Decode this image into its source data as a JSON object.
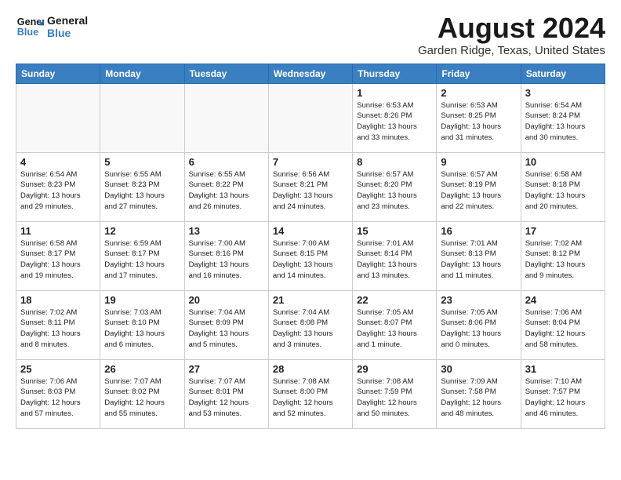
{
  "logo": {
    "line1": "General",
    "line2": "Blue"
  },
  "title": "August 2024",
  "location": "Garden Ridge, Texas, United States",
  "weekdays": [
    "Sunday",
    "Monday",
    "Tuesday",
    "Wednesday",
    "Thursday",
    "Friday",
    "Saturday"
  ],
  "weeks": [
    [
      {
        "day": "",
        "info": ""
      },
      {
        "day": "",
        "info": ""
      },
      {
        "day": "",
        "info": ""
      },
      {
        "day": "",
        "info": ""
      },
      {
        "day": "1",
        "info": "Sunrise: 6:53 AM\nSunset: 8:26 PM\nDaylight: 13 hours\nand 33 minutes."
      },
      {
        "day": "2",
        "info": "Sunrise: 6:53 AM\nSunset: 8:25 PM\nDaylight: 13 hours\nand 31 minutes."
      },
      {
        "day": "3",
        "info": "Sunrise: 6:54 AM\nSunset: 8:24 PM\nDaylight: 13 hours\nand 30 minutes."
      }
    ],
    [
      {
        "day": "4",
        "info": "Sunrise: 6:54 AM\nSunset: 8:23 PM\nDaylight: 13 hours\nand 29 minutes."
      },
      {
        "day": "5",
        "info": "Sunrise: 6:55 AM\nSunset: 8:23 PM\nDaylight: 13 hours\nand 27 minutes."
      },
      {
        "day": "6",
        "info": "Sunrise: 6:55 AM\nSunset: 8:22 PM\nDaylight: 13 hours\nand 26 minutes."
      },
      {
        "day": "7",
        "info": "Sunrise: 6:56 AM\nSunset: 8:21 PM\nDaylight: 13 hours\nand 24 minutes."
      },
      {
        "day": "8",
        "info": "Sunrise: 6:57 AM\nSunset: 8:20 PM\nDaylight: 13 hours\nand 23 minutes."
      },
      {
        "day": "9",
        "info": "Sunrise: 6:57 AM\nSunset: 8:19 PM\nDaylight: 13 hours\nand 22 minutes."
      },
      {
        "day": "10",
        "info": "Sunrise: 6:58 AM\nSunset: 8:18 PM\nDaylight: 13 hours\nand 20 minutes."
      }
    ],
    [
      {
        "day": "11",
        "info": "Sunrise: 6:58 AM\nSunset: 8:17 PM\nDaylight: 13 hours\nand 19 minutes."
      },
      {
        "day": "12",
        "info": "Sunrise: 6:59 AM\nSunset: 8:17 PM\nDaylight: 13 hours\nand 17 minutes."
      },
      {
        "day": "13",
        "info": "Sunrise: 7:00 AM\nSunset: 8:16 PM\nDaylight: 13 hours\nand 16 minutes."
      },
      {
        "day": "14",
        "info": "Sunrise: 7:00 AM\nSunset: 8:15 PM\nDaylight: 13 hours\nand 14 minutes."
      },
      {
        "day": "15",
        "info": "Sunrise: 7:01 AM\nSunset: 8:14 PM\nDaylight: 13 hours\nand 13 minutes."
      },
      {
        "day": "16",
        "info": "Sunrise: 7:01 AM\nSunset: 8:13 PM\nDaylight: 13 hours\nand 11 minutes."
      },
      {
        "day": "17",
        "info": "Sunrise: 7:02 AM\nSunset: 8:12 PM\nDaylight: 13 hours\nand 9 minutes."
      }
    ],
    [
      {
        "day": "18",
        "info": "Sunrise: 7:02 AM\nSunset: 8:11 PM\nDaylight: 13 hours\nand 8 minutes."
      },
      {
        "day": "19",
        "info": "Sunrise: 7:03 AM\nSunset: 8:10 PM\nDaylight: 13 hours\nand 6 minutes."
      },
      {
        "day": "20",
        "info": "Sunrise: 7:04 AM\nSunset: 8:09 PM\nDaylight: 13 hours\nand 5 minutes."
      },
      {
        "day": "21",
        "info": "Sunrise: 7:04 AM\nSunset: 8:08 PM\nDaylight: 13 hours\nand 3 minutes."
      },
      {
        "day": "22",
        "info": "Sunrise: 7:05 AM\nSunset: 8:07 PM\nDaylight: 13 hours\nand 1 minute."
      },
      {
        "day": "23",
        "info": "Sunrise: 7:05 AM\nSunset: 8:06 PM\nDaylight: 13 hours\nand 0 minutes."
      },
      {
        "day": "24",
        "info": "Sunrise: 7:06 AM\nSunset: 8:04 PM\nDaylight: 12 hours\nand 58 minutes."
      }
    ],
    [
      {
        "day": "25",
        "info": "Sunrise: 7:06 AM\nSunset: 8:03 PM\nDaylight: 12 hours\nand 57 minutes."
      },
      {
        "day": "26",
        "info": "Sunrise: 7:07 AM\nSunset: 8:02 PM\nDaylight: 12 hours\nand 55 minutes."
      },
      {
        "day": "27",
        "info": "Sunrise: 7:07 AM\nSunset: 8:01 PM\nDaylight: 12 hours\nand 53 minutes."
      },
      {
        "day": "28",
        "info": "Sunrise: 7:08 AM\nSunset: 8:00 PM\nDaylight: 12 hours\nand 52 minutes."
      },
      {
        "day": "29",
        "info": "Sunrise: 7:08 AM\nSunset: 7:59 PM\nDaylight: 12 hours\nand 50 minutes."
      },
      {
        "day": "30",
        "info": "Sunrise: 7:09 AM\nSunset: 7:58 PM\nDaylight: 12 hours\nand 48 minutes."
      },
      {
        "day": "31",
        "info": "Sunrise: 7:10 AM\nSunset: 7:57 PM\nDaylight: 12 hours\nand 46 minutes."
      }
    ]
  ]
}
